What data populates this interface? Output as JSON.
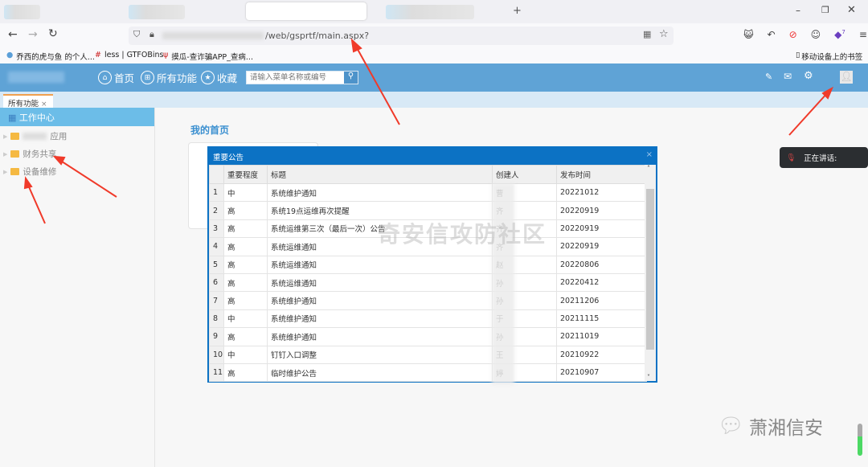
{
  "browser": {
    "url_suffix": "/web/gsprtf/main.aspx?",
    "bookmarks": [
      "乔西的虎与鱼 的个人...",
      "less | GTFOBins",
      "摸瓜-查诈骗APP_查病..."
    ],
    "mobile_bookmarks": "移动设备上的书签",
    "extension_badge": "7"
  },
  "header": {
    "nav": [
      {
        "label": "首页",
        "icon": "home-icon"
      },
      {
        "label": "所有功能",
        "icon": "grid-icon"
      },
      {
        "label": "收藏",
        "icon": "star-icon"
      }
    ],
    "search_placeholder": "请输入菜单名称或编号",
    "color": "#5fa3d6"
  },
  "tabs": [
    {
      "label": "所有功能",
      "close": "×"
    }
  ],
  "sidebar": {
    "header": "工作中心",
    "items": [
      {
        "label": "应用"
      },
      {
        "label": "财务共享"
      },
      {
        "label": "设备维修"
      }
    ]
  },
  "main": {
    "title": "我的首页"
  },
  "modal": {
    "title": "重要公告",
    "close": "×",
    "columns": [
      "",
      "重要程度",
      "标题",
      "创建人",
      "发布时间"
    ],
    "rows": [
      [
        "1",
        "中",
        "系统维护通知",
        "曹",
        "20221012"
      ],
      [
        "2",
        "高",
        "系统19点运维再次提醒",
        "齐",
        "20220919"
      ],
      [
        "3",
        "高",
        "系统运维第三次（最后一次）公告",
        "齐",
        "20220919"
      ],
      [
        "4",
        "高",
        "系统运维通知",
        "齐",
        "20220919"
      ],
      [
        "5",
        "高",
        "系统运维通知",
        "赵",
        "20220806"
      ],
      [
        "6",
        "高",
        "系统运维通知",
        "孙",
        "20220412"
      ],
      [
        "7",
        "高",
        "系统维护通知",
        "孙",
        "20211206"
      ],
      [
        "8",
        "中",
        "系统维护通知",
        "于",
        "20211115"
      ],
      [
        "9",
        "高",
        "系统维护通知",
        "孙",
        "20211019"
      ],
      [
        "10",
        "中",
        "钉钉入口调整",
        "王",
        "20210922"
      ],
      [
        "11",
        "高",
        "临时维护公告",
        "婷",
        "20210907"
      ]
    ]
  },
  "watermark": "奇安信攻防社区",
  "toast": {
    "text": "正在讲话:"
  },
  "logo": "萧湘信安"
}
